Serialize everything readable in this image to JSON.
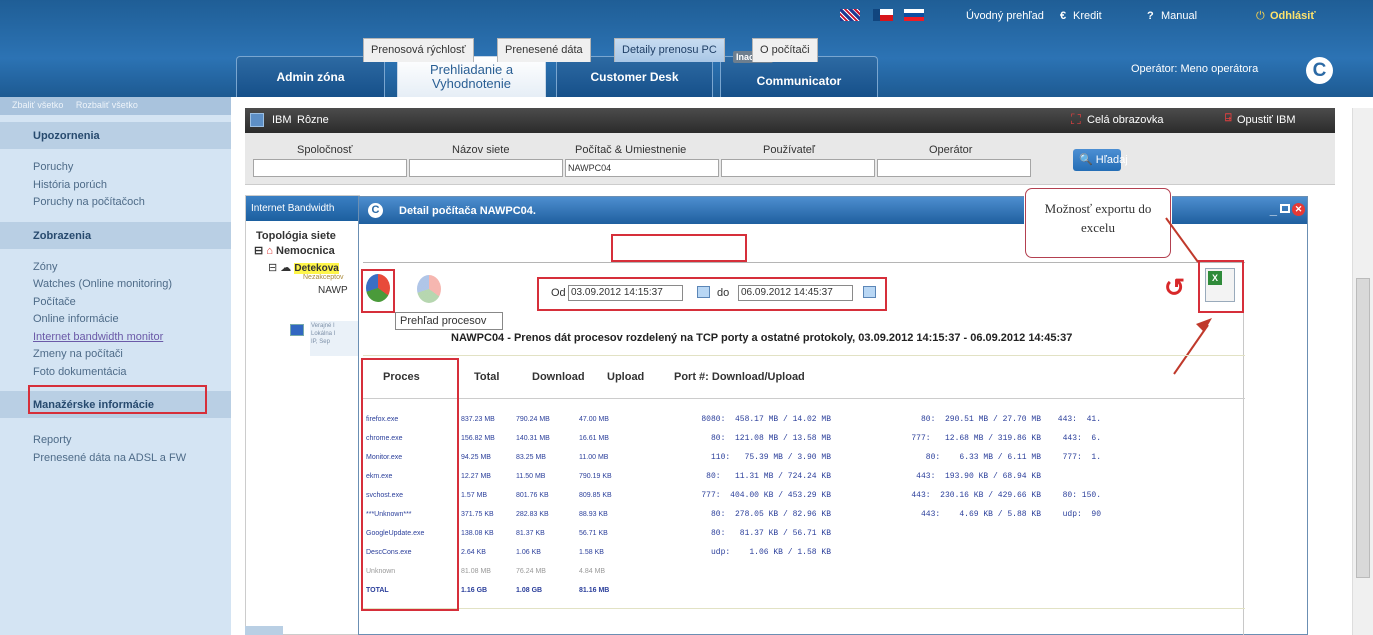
{
  "topnav": {
    "overview": "Úvodný prehľad",
    "credit": "Kredit",
    "manual": "Manual",
    "logout": "Odhlásiť",
    "operator": "Operátor: Meno operátora"
  },
  "tabs": [
    {
      "label": "Admin zóna"
    },
    {
      "label": "Prehliadanie a Vyhodnotenie"
    },
    {
      "label": "Customer Desk"
    },
    {
      "label": "Communicator",
      "badge": "Inactive"
    }
  ],
  "sidebar": {
    "collapse_all": "Zbaliť všetko",
    "expand_all": "Rozbaliť všetko",
    "sections": [
      {
        "title": "Upozornenia",
        "items": [
          "Poruchy",
          "História porúch",
          "Poruchy na počítačoch"
        ]
      },
      {
        "title": "Zobrazenia",
        "items": [
          "Zóny",
          "Watches (Online monitoring)",
          "Počítače",
          "Online informácie",
          "Internet bandwidth monitor",
          "Zmeny na počítači",
          "Foto dokumentácia"
        ]
      },
      {
        "title": "Manažérske informácie",
        "items": [
          "Reporty",
          "Prenesené dáta na ADSL a FW"
        ]
      }
    ]
  },
  "ibmbar": {
    "title": "IBM",
    "menu": "Rôzne",
    "fullscreen": "Celá obrazovka",
    "leave": "Opustiť IBM"
  },
  "filter": {
    "company": "Spoločnosť",
    "network": "Názov siete",
    "computer": "Počítač & Umiestnenie",
    "user": "Používateľ",
    "operator": "Operátor",
    "computer_value": "NAWPC04",
    "search": "Hľadaj"
  },
  "panel": {
    "title": "Internet Bandwidth",
    "topology": "Topológia siete",
    "node1": "Nemocnica",
    "node2": "Detekova",
    "node2_sub": "Nezakceptov",
    "node3": "NAWP",
    "node3_lines": [
      "Verajné I",
      "Lokálna I",
      "IP, Sep"
    ]
  },
  "dialog": {
    "title": "Detail počítača NAWPC04.",
    "tabs": [
      "Prenosová rýchlosť",
      "Prenesené dáta",
      "Detaily prenosu PC",
      "O počítači"
    ],
    "from_label": "Od",
    "from_value": "03.09.2012 14:15:37",
    "to_label": "do",
    "to_value": "06.09.2012 14:45:37",
    "tooltip": "Prehľad procesov",
    "report_title": "NAWPC04 - Prenos dát procesov rozdelený na TCP porty a ostatné protokoly, 03.09.2012 14:15:37 - 06.09.2012 14:45:37",
    "headers": [
      "Proces",
      "Total",
      "Download",
      "Upload",
      "Port #: Download/Upload"
    ],
    "rows": [
      [
        "firefox.exe",
        "837.23 MB",
        "790.24 MB",
        "47.00 MB",
        "8080:  458.17 MB / 14.02 MB",
        "80:  290.51 MB / 27.70 MB",
        "443:  41."
      ],
      [
        "chrome.exe",
        "156.82 MB",
        "140.31 MB",
        "16.61 MB",
        "80:  121.08 MB / 13.58 MB",
        "777:   12.68 MB / 319.86 KB",
        "443:  6."
      ],
      [
        "Monitor.exe",
        "94.25 MB",
        "83.25 MB",
        "11.00 MB",
        "110:   75.39 MB / 3.90 MB",
        "80:    6.33 MB / 6.11 MB",
        "777:  1."
      ],
      [
        "ekm.exe",
        "12.27 MB",
        "11.50 MB",
        "790.19 KB",
        "80:   11.31 MB / 724.24 KB",
        "443:  193.90 KB / 68.94 KB",
        ""
      ],
      [
        "svchost.exe",
        "1.57 MB",
        "801.76 KB",
        "809.85 KB",
        "777:  404.00 KB / 453.29 KB",
        "443:  230.16 KB / 429.66 KB",
        "80: 150."
      ],
      [
        "***Unknown***",
        "371.75 KB",
        "282.83 KB",
        "88.93 KB",
        "80:  278.05 KB / 82.96 KB",
        "443:    4.69 KB / 5.88 KB",
        "udp:  90"
      ],
      [
        "GoogleUpdate.exe",
        "138.08 KB",
        "81.37 KB",
        "56.71 KB",
        "80:   81.37 KB / 56.71 KB",
        "",
        ""
      ],
      [
        "DescCons.exe",
        "2.64 KB",
        "1.06 KB",
        "1.58 KB",
        "udp:    1.06 KB / 1.58 KB",
        "",
        ""
      ],
      [
        "Unknown",
        "81.08 MB",
        "76.24 MB",
        "4.84 MB",
        "",
        "",
        ""
      ],
      [
        "TOTAL",
        "1.16 GB",
        "1.08 GB",
        "81.16 MB",
        "",
        "",
        ""
      ]
    ]
  },
  "callout": "Možnosť exportu do excelu"
}
